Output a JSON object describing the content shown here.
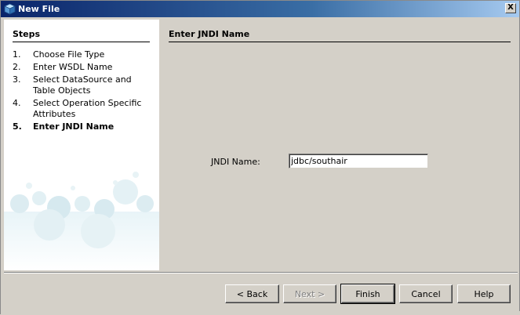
{
  "window": {
    "title": "New File",
    "close_label": "X"
  },
  "steps": {
    "heading": "Steps",
    "items": [
      {
        "num": "1.",
        "label": "Choose File Type"
      },
      {
        "num": "2.",
        "label": "Enter WSDL Name"
      },
      {
        "num": "3.",
        "label": "Select DataSource and Table Objects"
      },
      {
        "num": "4.",
        "label": "Select Operation Specific Attributes"
      },
      {
        "num": "5.",
        "label": "Enter JNDI Name"
      }
    ],
    "current_index": 4
  },
  "content": {
    "heading": "Enter JNDI Name",
    "jndi_label": "JNDI Name:",
    "jndi_value": "jdbc/southair"
  },
  "buttons": {
    "back": "< Back",
    "next": "Next >",
    "finish": "Finish",
    "cancel": "Cancel",
    "help": "Help"
  },
  "colors": {
    "titlebar_start": "#0a246a",
    "titlebar_end": "#a6caf0",
    "dialog_bg": "#d4d0c8",
    "bubble": "#cfe6ee"
  }
}
